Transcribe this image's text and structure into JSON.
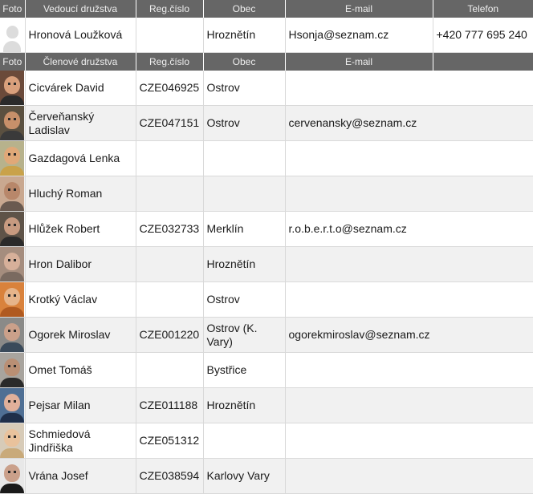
{
  "leader_header": {
    "foto": "Foto",
    "name": "Vedoucí družstva",
    "reg": "Reg.číslo",
    "obec": "Obec",
    "email": "E-mail",
    "telefon": "Telefon"
  },
  "leader": {
    "name": "Hronová Loužková",
    "reg": "",
    "obec": "Hroznětín",
    "email": "Hsonja@seznam.cz",
    "telefon": "+420 777 695 240"
  },
  "members_header": {
    "foto": "Foto",
    "name": "Členové družstva",
    "reg": "Reg.číslo",
    "obec": "Obec",
    "email": "E-mail"
  },
  "members": [
    {
      "name": "Cicvárek David",
      "reg": "CZE046925",
      "obec": "Ostrov",
      "email": ""
    },
    {
      "name": "Červeňanský Ladislav",
      "reg": "CZE047151",
      "obec": "Ostrov",
      "email": "cervenansky@seznam.cz"
    },
    {
      "name": "Gazdagová Lenka",
      "reg": "",
      "obec": "",
      "email": ""
    },
    {
      "name": "Hluchý Roman",
      "reg": "",
      "obec": "",
      "email": ""
    },
    {
      "name": "Hlůžek Robert",
      "reg": "CZE032733",
      "obec": "Merklín",
      "email": "r.o.b.e.r.t.o@seznam.cz"
    },
    {
      "name": "Hron Dalibor",
      "reg": "",
      "obec": "Hroznětín",
      "email": ""
    },
    {
      "name": "Krotký Václav",
      "reg": "",
      "obec": "Ostrov",
      "email": ""
    },
    {
      "name": "Ogorek Miroslav",
      "reg": "CZE001220",
      "obec": "Ostrov (K. Vary)",
      "email": "ogorekmiroslav@seznam.cz"
    },
    {
      "name": "Omet Tomáš",
      "reg": "",
      "obec": "Bystřice",
      "email": ""
    },
    {
      "name": "Pejsar Milan",
      "reg": "CZE011188",
      "obec": "Hroznětín",
      "email": ""
    },
    {
      "name": "Schmiedová Jindřiška",
      "reg": "CZE051312",
      "obec": "",
      "email": ""
    },
    {
      "name": "Vrána Josef",
      "reg": "CZE038594",
      "obec": "Karlovy Vary",
      "email": ""
    }
  ],
  "photo_colors": [
    {
      "bg": "#6b4a3a",
      "skin": "#d9a07c",
      "shirt": "#2b2b2b"
    },
    {
      "bg": "#5a5040",
      "skin": "#c7906a",
      "shirt": "#3a3a3a"
    },
    {
      "bg": "#b7b28c",
      "skin": "#e0a878",
      "shirt": "#c9a24a"
    },
    {
      "bg": "#c9a890",
      "skin": "#b8876a",
      "shirt": "#6a5a50"
    },
    {
      "bg": "#5e5348",
      "skin": "#c79a80",
      "shirt": "#2a2a2a"
    },
    {
      "bg": "#a58d7e",
      "skin": "#d7b09a",
      "shirt": "#7a6a60"
    },
    {
      "bg": "#d9823c",
      "skin": "#e6b48a",
      "shirt": "#b05a20"
    },
    {
      "bg": "#8a8a88",
      "skin": "#caa08a",
      "shirt": "#3a4a5a"
    },
    {
      "bg": "#a8a49e",
      "skin": "#b98f74",
      "shirt": "#2a2a2a"
    },
    {
      "bg": "#4f6f94",
      "skin": "#e1b09a",
      "shirt": "#1f2f4a"
    },
    {
      "bg": "#d7cbb8",
      "skin": "#e9c29c",
      "shirt": "#c9aa7a"
    },
    {
      "bg": "#e8e8e8",
      "skin": "#caa08a",
      "shirt": "#1a1a1a"
    }
  ]
}
